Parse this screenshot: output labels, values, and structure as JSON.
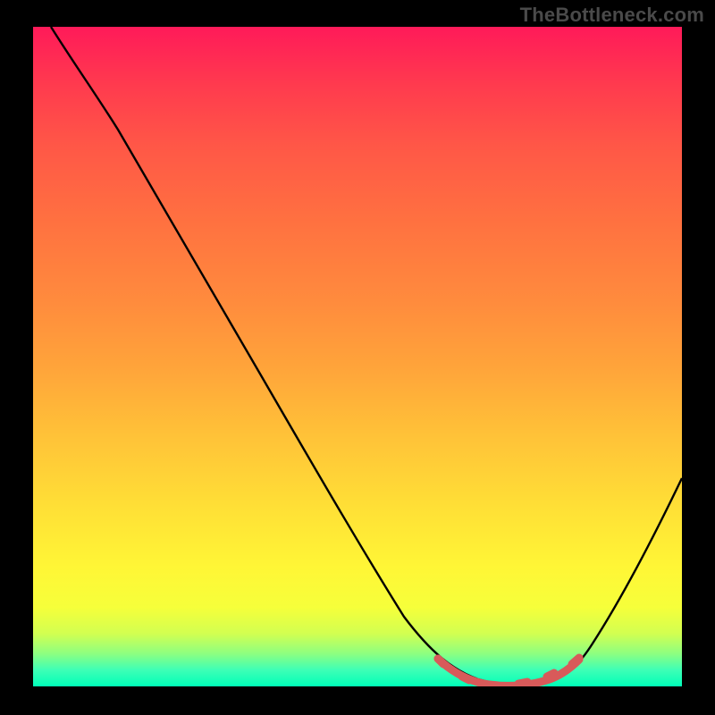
{
  "watermark": "TheBottleneck.com",
  "colors": {
    "background": "#000000",
    "curve_stroke": "#000000",
    "marker_stroke": "#d85a5a",
    "gradient_top": "#ff1a59",
    "gradient_bottom": "#00ffb8",
    "watermark_text": "#4a4a4a"
  },
  "chart_data": {
    "type": "line",
    "title": "",
    "xlabel": "",
    "ylabel": "",
    "xlim": [
      0,
      100
    ],
    "ylim": [
      0,
      100
    ],
    "x": [
      5,
      10,
      15,
      20,
      25,
      30,
      35,
      40,
      45,
      50,
      55,
      60,
      62,
      65,
      68,
      70,
      72,
      75,
      78,
      80,
      82,
      85,
      90,
      95,
      100
    ],
    "values": [
      100,
      95,
      89,
      81,
      73,
      65,
      57,
      49,
      41,
      33,
      25,
      17,
      13,
      8,
      5,
      3,
      2,
      1,
      0.5,
      0.5,
      1,
      3,
      10,
      20,
      32
    ],
    "series": [
      {
        "name": "bottleneck-curve",
        "x": [
          5,
          10,
          15,
          20,
          25,
          30,
          35,
          40,
          45,
          50,
          55,
          60,
          62,
          65,
          68,
          70,
          72,
          75,
          78,
          80,
          82,
          85,
          90,
          95,
          100
        ],
        "y": [
          100,
          95,
          89,
          81,
          73,
          65,
          57,
          49,
          41,
          33,
          25,
          17,
          13,
          8,
          5,
          3,
          2,
          1,
          0.5,
          0.5,
          1,
          3,
          10,
          20,
          32
        ]
      }
    ],
    "highlighted_range_x": [
      65,
      84
    ],
    "minimum_x": 79
  }
}
